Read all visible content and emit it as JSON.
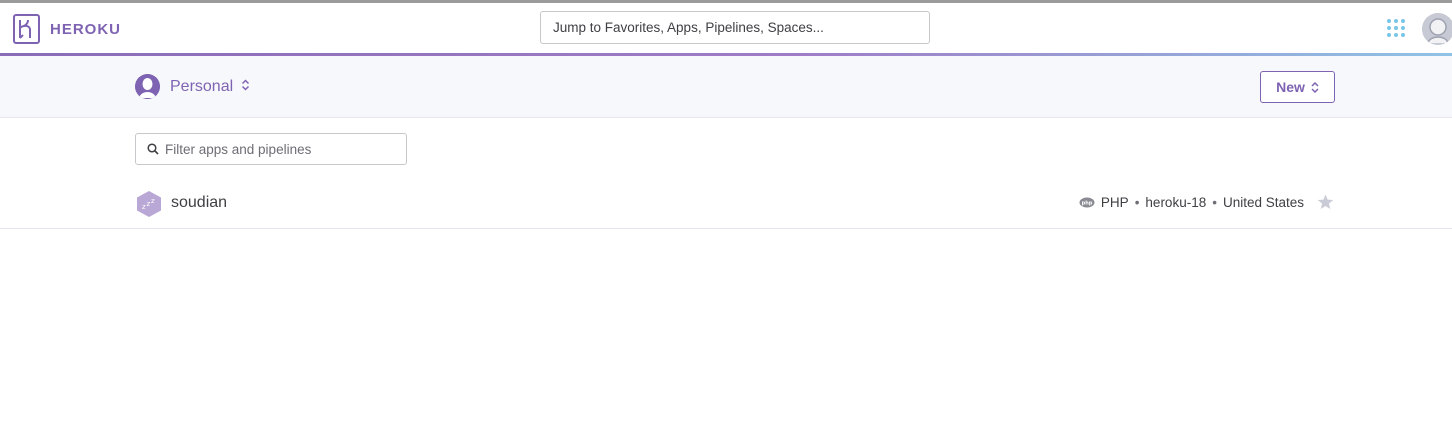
{
  "header": {
    "brand": "HEROKU",
    "search_placeholder": "Jump to Favorites, Apps, Pipelines, Spaces..."
  },
  "account": {
    "name": "Personal",
    "new_button_label": "New"
  },
  "filter": {
    "placeholder": "Filter apps and pipelines"
  },
  "apps": [
    {
      "name": "soudian",
      "language": "PHP",
      "stack": "heroku-18",
      "region": "United States",
      "icon": "sleeping-app-icon"
    }
  ],
  "colors": {
    "brand": "#7f63b3",
    "grid_icon": "#79c6e6"
  }
}
